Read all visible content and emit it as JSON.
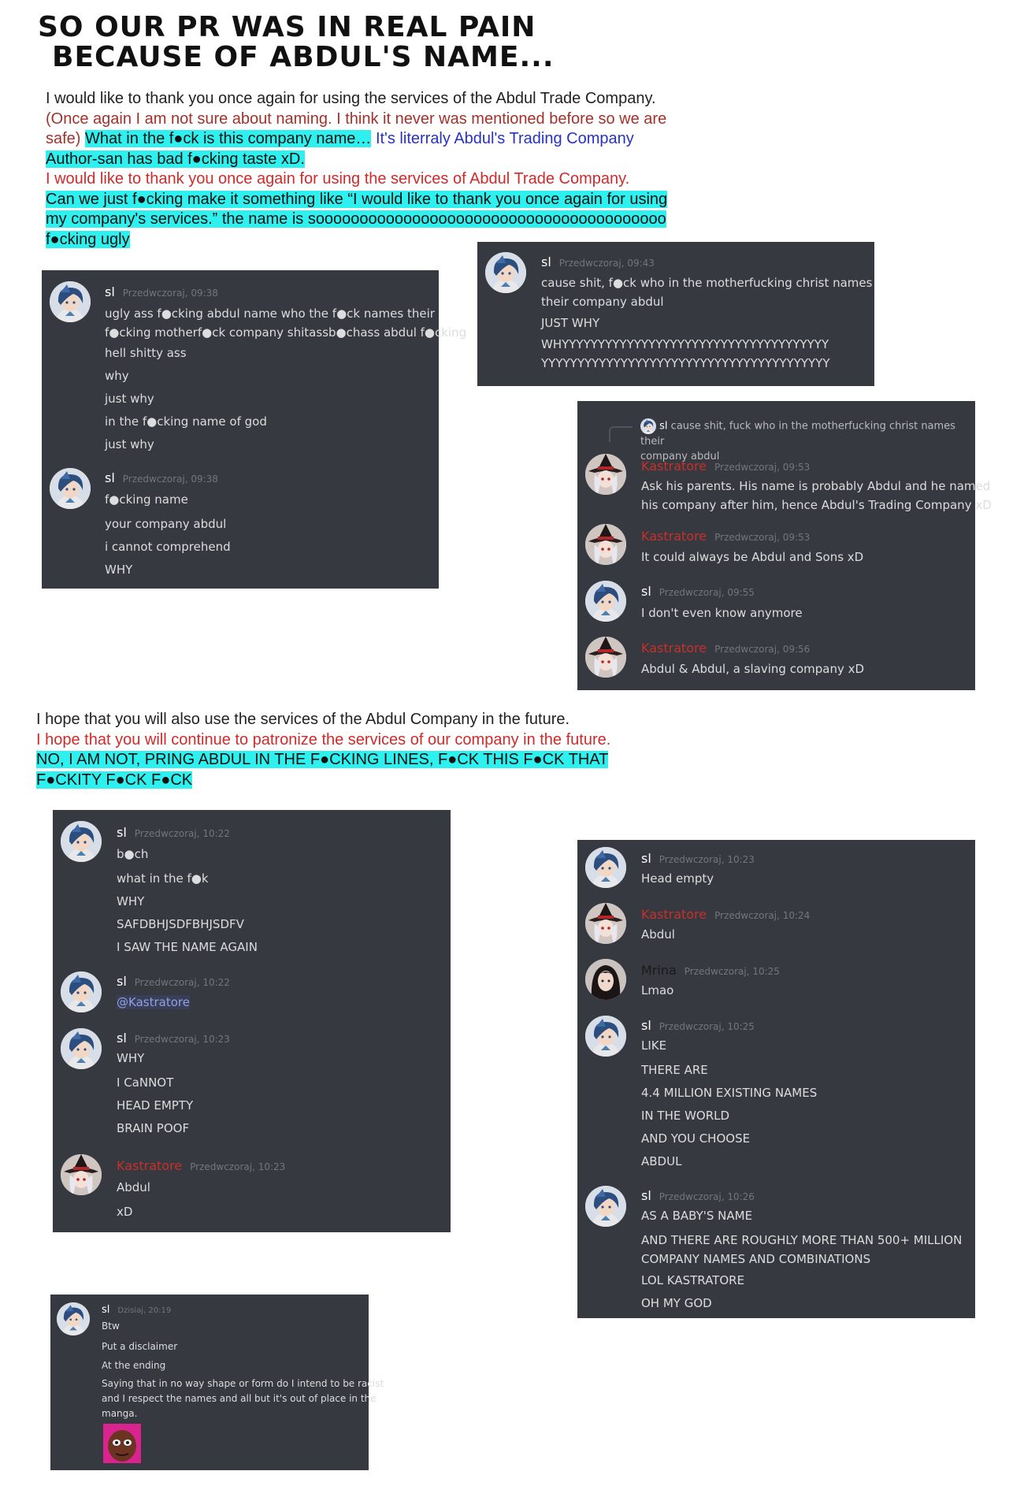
{
  "title": {
    "line1": "SO OUR PR WAS IN REAL PAIN",
    "line2": "BECAUSE OF ABDUL'S NAME..."
  },
  "doc1": {
    "l1": "I would like to thank you once again for using the services of the Abdul Trade Company.",
    "l2": "(Once again I am not sure about naming. I think it never was mentioned before so we are",
    "l3a": "safe)",
    "l3b": "What in the f●ck is this company name…",
    "l3c": "It's literraly Abdul's Trading Company",
    "l4": "Author-san has bad f●cking taste xD.",
    "l5": "I would like to thank you once again for using the services of Abdul Trade Company.",
    "l6": "Can we just f●cking make it something like “I would like to thank you once again for using",
    "l7": "my company's services.” the name is soooooooooooooooooooooooooooooooooooooooo",
    "l8": "f●cking ugly"
  },
  "doc2": {
    "l1": "I hope that you will also use the services of the Abdul Company in the future.",
    "l2": "I hope that you will continue to patronize the services of our company in the future.",
    "l3": "NO, I AM NOT, PRING ABDUL IN THE F●CKING LINES, F●CK THIS F●CK THAT",
    "l4": "F●CKITY F●CK F●CK"
  },
  "chat1": {
    "m1": {
      "user": "sl",
      "time": "Przedwczoraj, 09:38",
      "lines": [
        "ugly ass f●cking abdul name who the f●ck names their",
        "f●cking motherf●ck company shitassb●chass abdul f●cking",
        "hell shitty ass",
        "why",
        "just why",
        "in the f●cking name of god",
        "just why"
      ]
    },
    "m2": {
      "user": "sl",
      "time": "Przedwczoraj, 09:38",
      "lines": [
        "f●cking name",
        "your company abdul",
        "i cannot comprehend",
        "WHY"
      ]
    }
  },
  "chat2": {
    "m1": {
      "user": "sl",
      "time": "Przedwczoraj, 09:43",
      "lines": [
        "cause shit, f●ck who in the motherfucking christ names",
        "their company abdul",
        "JUST WHY",
        "WHYYYYYYYYYYYYYYYYYYYYYYYYYYYYYYYYYYYYY",
        "YYYYYYYYYYYYYYYYYYYYYYYYYYYYYYYYYYYYYYYY"
      ]
    }
  },
  "chat3": {
    "reply_user": "sl",
    "reply_text_1": "cause shit, fuck who in the motherfucking christ names their",
    "reply_text_2": "company abdul",
    "m1": {
      "user": "Kastratore",
      "time": "Przedwczoraj, 09:53",
      "lines": [
        "Ask his parents. His name is probably Abdul and he named",
        "his company after him, hence Abdul's Trading Company xD"
      ]
    },
    "m2": {
      "user": "Kastratore",
      "time": "Przedwczoraj, 09:53",
      "lines": [
        "It could always be Abdul and Sons xD"
      ]
    },
    "m3": {
      "user": "sl",
      "time": "Przedwczoraj, 09:55",
      "lines": [
        "I don't even know anymore"
      ]
    },
    "m4": {
      "user": "Kastratore",
      "time": "Przedwczoraj, 09:56",
      "lines": [
        "Abdul & Abdul, a slaving company xD"
      ]
    }
  },
  "chat4": {
    "m1": {
      "user": "sl",
      "time": "Przedwczoraj, 10:22",
      "lines": [
        "b●ch",
        "what in the f●k",
        "WHY",
        "SAFDBHJSDFBHJSDFV",
        "I SAW THE NAME AGAIN"
      ]
    },
    "m2": {
      "user": "sl",
      "time": "Przedwczoraj, 10:22",
      "lines": [
        "@Kastratore"
      ]
    },
    "m3": {
      "user": "sl",
      "time": "Przedwczoraj, 10:23",
      "lines": [
        "WHY",
        "I CaNNOT",
        "HEAD EMPTY",
        "BRAIN POOF"
      ]
    },
    "m4": {
      "user": "Kastratore",
      "time": "Przedwczoraj, 10:23",
      "lines": [
        "Abdul",
        "xD"
      ]
    }
  },
  "chat5": {
    "m1": {
      "user": "sl",
      "time": "Przedwczoraj, 10:23",
      "lines": [
        "Head empty"
      ]
    },
    "m2": {
      "user": "Kastratore",
      "time": "Przedwczoraj, 10:24",
      "lines": [
        "Abdul"
      ]
    },
    "m3": {
      "user": "Mrina",
      "time": "Przedwczoraj, 10:25",
      "lines": [
        "Lmao"
      ]
    },
    "m4": {
      "user": "sl",
      "time": "Przedwczoraj, 10:25",
      "lines": [
        "LIKE",
        "THERE ARE",
        "4.4 MILLION EXISTING NAMES",
        "IN THE WORLD",
        "AND YOU CHOOSE",
        "ABDUL"
      ]
    },
    "m5": {
      "user": "sl",
      "time": "Przedwczoraj, 10:26",
      "lines": [
        "AS A BABY'S NAME",
        "AND THERE ARE ROUGHLY MORE THAN 500+ MILLION",
        "COMPANY NAMES AND COMBINATIONS",
        "LOL KASTRATORE",
        "OH MY GOD"
      ]
    }
  },
  "chat6": {
    "m1": {
      "user": "sl",
      "time": "Dzisiaj, 20:19",
      "lines": [
        "Btw",
        "Put a disclaimer",
        "At the ending",
        "Saying that in no way shape or form do I intend to be racist",
        "and I respect the names and all but it's out of place in the",
        "manga."
      ]
    }
  },
  "icons": {
    "avatar_sl": "blue-haired-anime-avatar",
    "avatar_k": "witch-hat-anime-avatar",
    "avatar_m": "dark-haired-avatar",
    "emoji": "face-emoji"
  },
  "colors": {
    "panel": "#36393f",
    "highlight": "#2ef0ef",
    "red": "#d12a2a",
    "blue": "#2533c4",
    "kastratore": "#c7302b"
  }
}
